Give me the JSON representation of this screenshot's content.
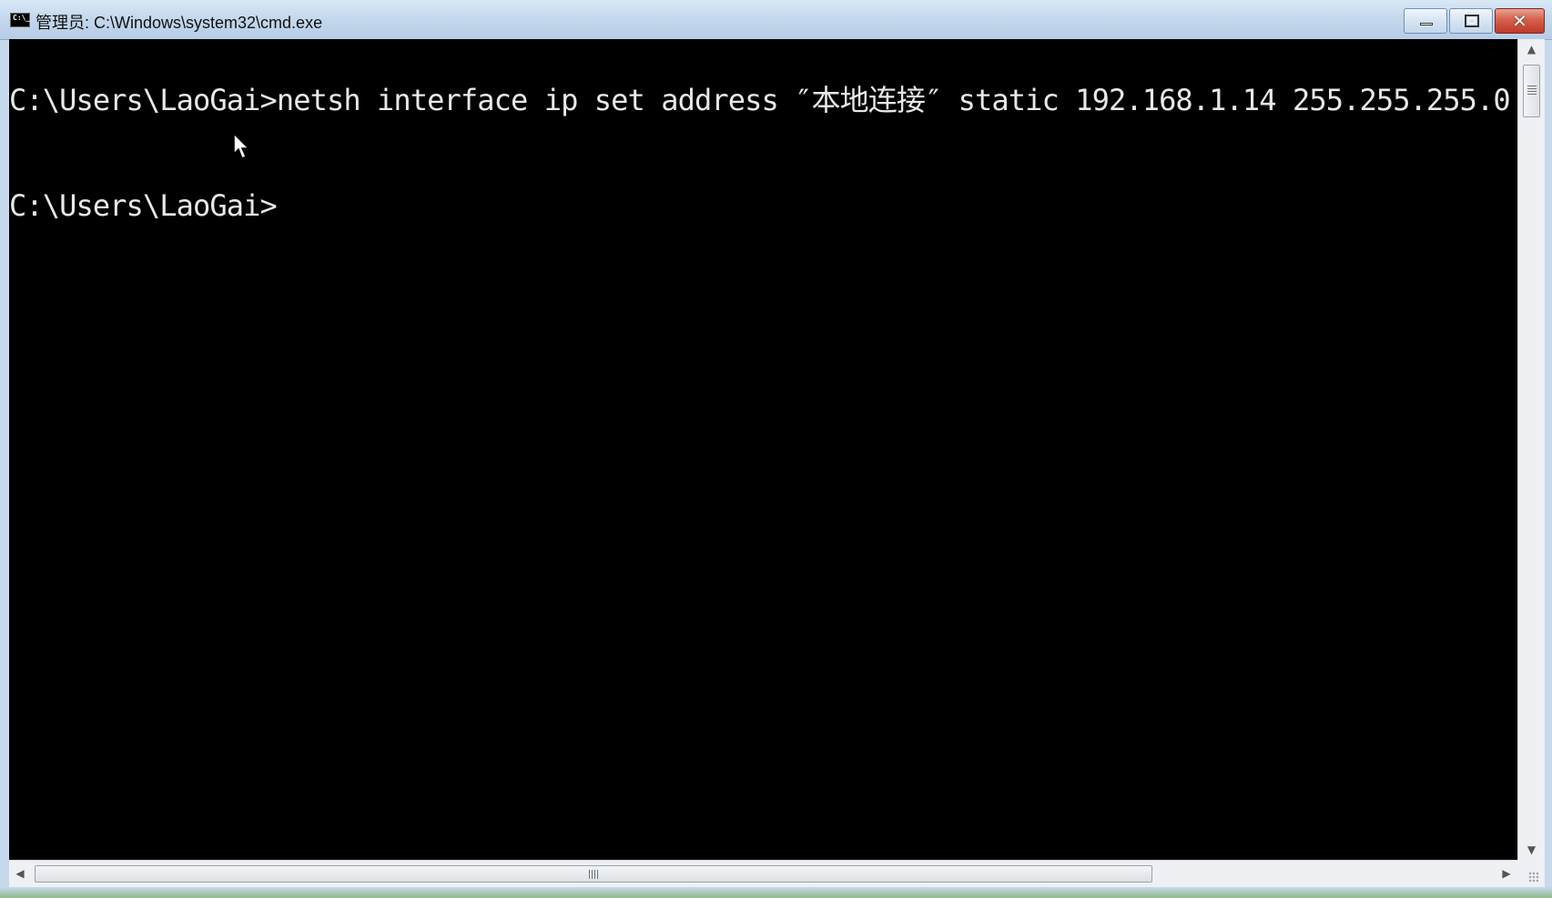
{
  "window": {
    "title": "管理员: C:\\Windows\\system32\\cmd.exe",
    "icon": "cmd-icon",
    "icon_text": "C:\\_",
    "controls": {
      "minimize_icon": "minimize-icon",
      "maximize_icon": "maximize-icon",
      "close_icon": "close-icon",
      "close_glyph": "✕"
    }
  },
  "console": {
    "lines": [
      "C:\\Users\\LaoGai>netsh interface ip set address ″本地连接″ static 192.168.1.14 255.255.255.0",
      "C:\\Users\\LaoGai>"
    ],
    "background": "#000000",
    "foreground": "#e8e8e8"
  },
  "scrollbars": {
    "vertical": {
      "up_arrow": "▲",
      "down_arrow": "▼"
    },
    "horizontal": {
      "left_arrow": "◀",
      "right_arrow": "▶"
    }
  },
  "colors": {
    "titlebar": "#c3d7ec",
    "close_button": "#c0392b"
  }
}
